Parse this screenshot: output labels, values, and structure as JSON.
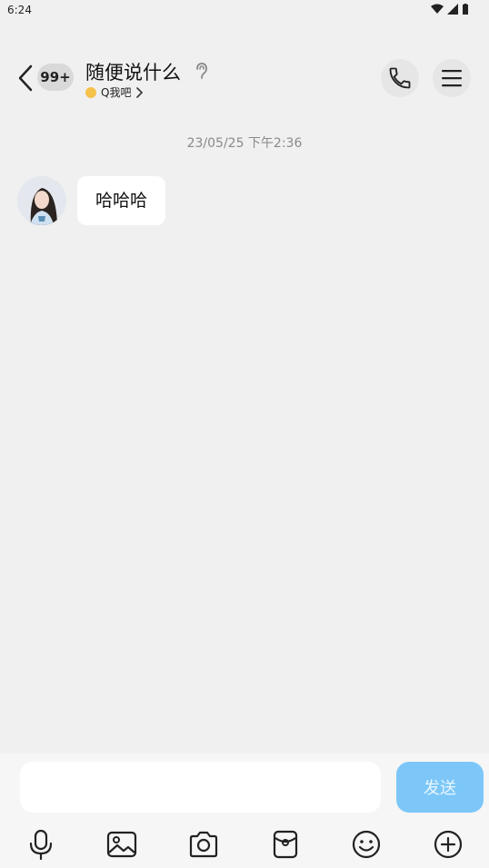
{
  "status_bar": {
    "time": "6:24"
  },
  "header": {
    "unread_badge": "99+",
    "title": "随便说什么",
    "subtitle": "Q我吧",
    "icons": [
      "back-arrow-icon",
      "ear-icon",
      "phone-icon",
      "menu-icon",
      "chevron-right-icon"
    ]
  },
  "chat": {
    "timestamp": "23/05/25 下午2:36",
    "messages": [
      {
        "text": "哈哈哈",
        "from": "other"
      }
    ]
  },
  "composer": {
    "input_value": "",
    "send_label": "发送"
  },
  "toolbar": {
    "icons": [
      "microphone-icon",
      "image-icon",
      "camera-icon",
      "red-packet-icon",
      "emoji-icon",
      "plus-icon"
    ]
  },
  "colors": {
    "background": "#f0f0f0",
    "send_button": "#7cc7f8",
    "timestamp_text": "#8a8a8a"
  }
}
